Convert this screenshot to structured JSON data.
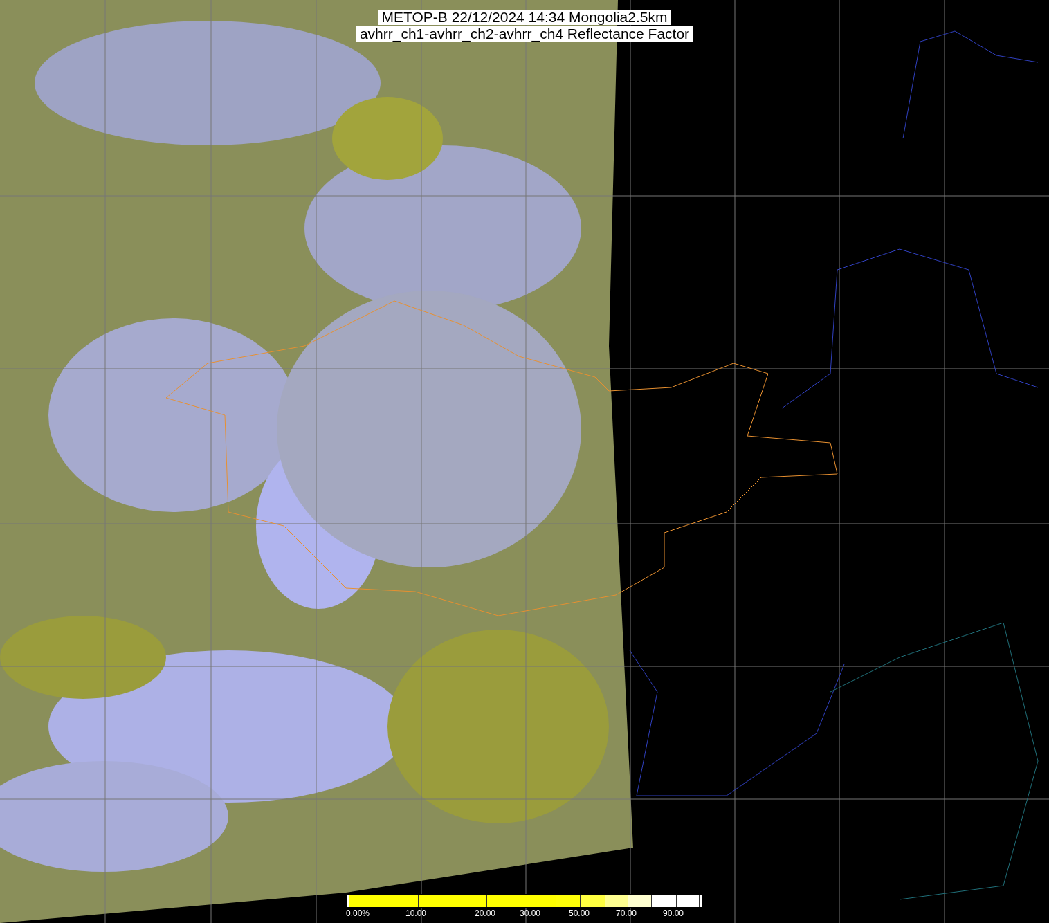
{
  "title": {
    "lines": [
      "METOP-B 22/12/2024 14:34 Mongolia2.5km",
      "avhrr_ch1-avhrr_ch2-avhrr_ch4 Reflectance Factor"
    ]
  },
  "colorbar": {
    "ticks": [
      "0.00%",
      "10.00",
      "20.00",
      "30.00",
      "50.00",
      "70.00",
      "90.00"
    ]
  }
}
